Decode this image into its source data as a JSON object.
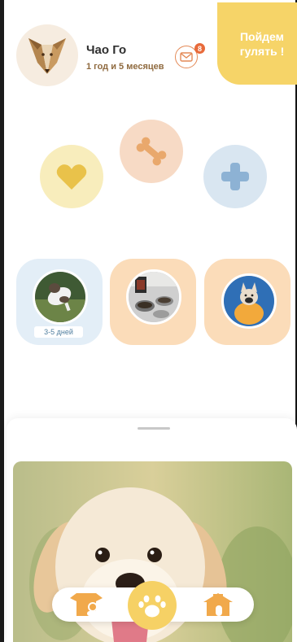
{
  "header": {
    "pet_name": "Чао Го",
    "pet_age": "1 год и 5 месяцев",
    "mail_icon": "mail-icon",
    "mail_count": "8",
    "walk_button": "Пойдем\nгулять !"
  },
  "actions": [
    {
      "icon": "heart-icon",
      "color": "#e9c24a"
    },
    {
      "icon": "bone-icon",
      "color": "#e9a86c"
    },
    {
      "icon": "plus-icon",
      "color": "#8db2d4"
    }
  ],
  "cards": [
    {
      "badge": "3-5 дней",
      "photo": "dog-jumping-photo"
    },
    {
      "photo": "dog-food-bowls-photo"
    },
    {
      "photo": "french-bulldog-photo"
    }
  ],
  "nav": {
    "items": [
      {
        "icon": "pet-profile-icon"
      },
      {
        "icon": "paw-icon",
        "active": true
      },
      {
        "icon": "house-icon"
      }
    ],
    "accent": "#f6d165"
  },
  "colors": {
    "accent_yellow": "#f6d468",
    "accent_orange": "#e48a57",
    "badge_text": "#4f7e9f"
  }
}
